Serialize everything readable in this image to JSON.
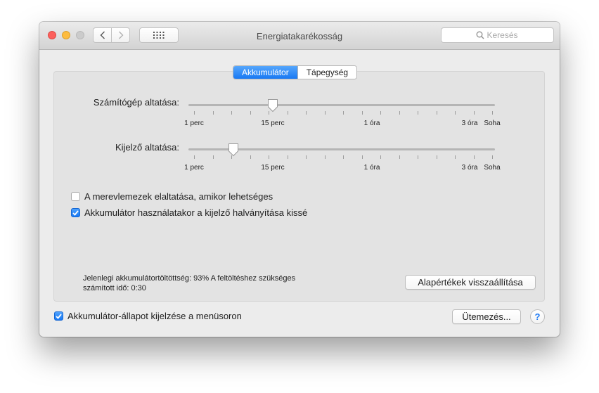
{
  "window": {
    "title": "Energiatakarékosság",
    "search_placeholder": "Keresés"
  },
  "tabs": [
    {
      "label": "Akkumulátor",
      "active": true
    },
    {
      "label": "Tápegység",
      "active": false
    }
  ],
  "sliders": [
    {
      "label": "Számítógép altatása:",
      "tick_labels": [
        "1 perc",
        "15 perc",
        "1 óra",
        "3 óra",
        "Soha"
      ],
      "value": "15 perc"
    },
    {
      "label": "Kijelző altatása:",
      "tick_labels": [
        "1 perc",
        "15 perc",
        "1 óra",
        "3 óra",
        "Soha"
      ],
      "value": "5 perc"
    }
  ],
  "options": [
    {
      "label": "A merevlemezek elaltatása, amikor lehetséges",
      "checked": false
    },
    {
      "label": "Akkumulátor használatakor a kijelző halványítása kissé",
      "checked": true
    }
  ],
  "status": {
    "line1": "Jelenlegi akkumulátortöltöttség: 93%  A feltöltéshez szükséges",
    "line2": "számított idő: 0:30"
  },
  "buttons": {
    "restore_defaults": "Alapértékek visszaállítása",
    "schedule": "Ütemezés...",
    "help": "?"
  },
  "footer": {
    "menubar_option": {
      "label": "Akkumulátor-állapot kijelzése a menüsoron",
      "checked": true
    }
  },
  "colors": {
    "accent": "#1878f3",
    "close": "#fc605c",
    "minimize": "#fdbc40",
    "zoom_disabled": "#cbcbcb"
  }
}
